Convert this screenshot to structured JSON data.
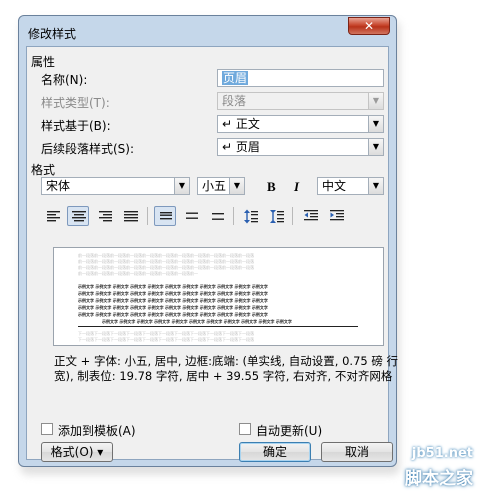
{
  "window": {
    "title": "修改样式",
    "close_glyph": "✕"
  },
  "properties": {
    "section_label": "属性",
    "name_label": "名称(N):",
    "name_value": "页眉",
    "style_type_label": "样式类型(T):",
    "style_type_value": "段落",
    "based_on_label": "样式基于(B):",
    "based_on_value": "↵ 正文",
    "next_style_label": "后续段落样式(S):",
    "next_style_value": "↵ 页眉"
  },
  "format": {
    "section_label": "格式",
    "font": "宋体",
    "size": "小五",
    "bold_glyph": "B",
    "italic_glyph": "I",
    "script": "中文"
  },
  "preview": {
    "prev_text": "前一段落前一段落前一段落前一段落前一段落前一段落前一段落前一段落前一段落前一段落前一段落",
    "sample_text": "示例文字 示例文字 示例文字 示例文字 示例文字 示例文字 示例文字 示例文字 示例文字 示例文字 示例文字",
    "next_text": "下一段落下一段落下一段落下一段落下一段落下一段落下一段落下一段落下一段落下一段落下一段落"
  },
  "description": "正文 + 字体: 小五, 居中, 边框:底端: (单实线, 自动设置, 0.75 磅 行宽), 制表位: 19.78 字符, 居中 + 39.55 字符, 右对齐, 不对齐网格",
  "options": {
    "add_to_template": "添加到模板(A)",
    "auto_update": "自动更新(U)"
  },
  "buttons": {
    "format": "格式(O) ▾",
    "ok": "确定",
    "cancel": "取消"
  },
  "watermark": {
    "site": "jb51.net",
    "name": "脚本之家"
  }
}
